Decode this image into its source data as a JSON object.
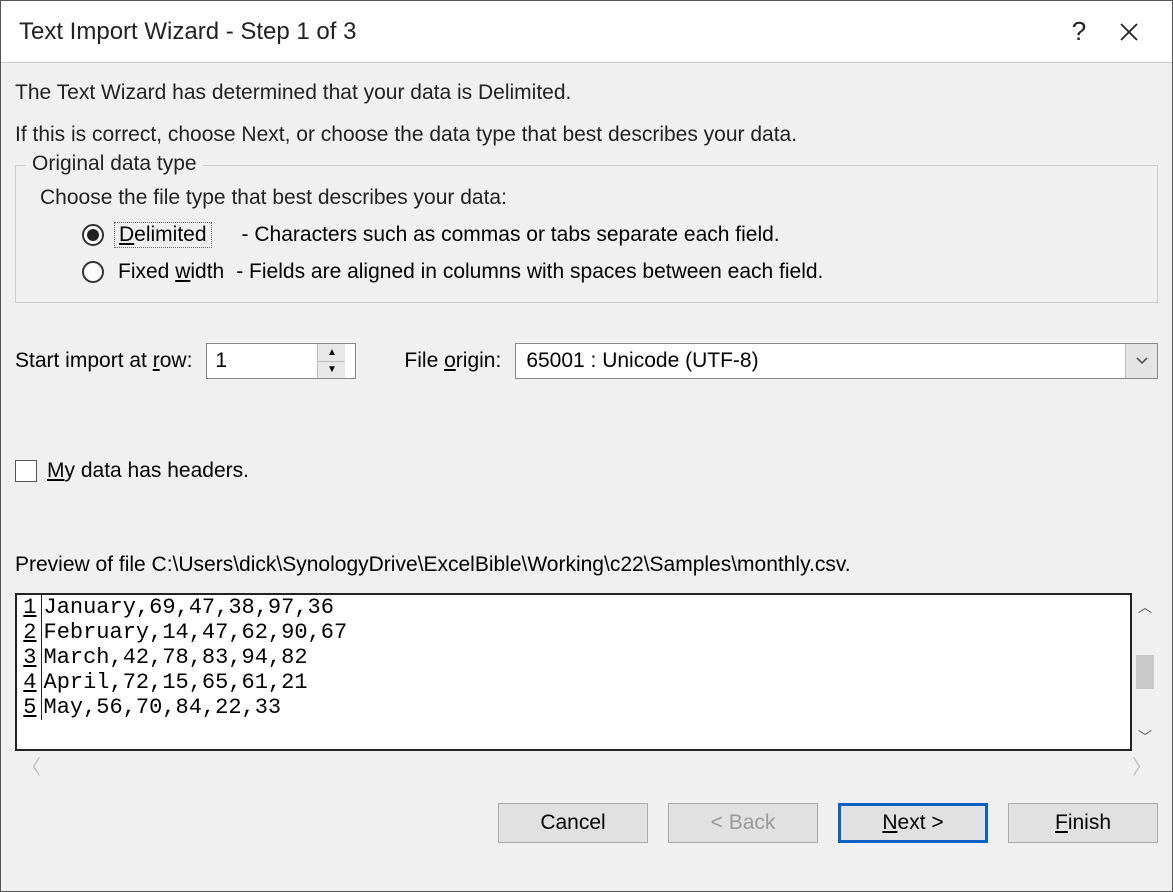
{
  "title": "Text Import Wizard - Step 1 of 3",
  "intro": {
    "line1": "The Text Wizard has determined that your data is Delimited.",
    "line2": "If this is correct, choose Next, or choose the data type that best describes your data."
  },
  "group": {
    "legend": "Original data type",
    "instruction": "Choose the file type that best describes your data:",
    "options": [
      {
        "label_pre": "",
        "label_u": "D",
        "label_post": "elimited",
        "desc": "- Characters such as commas or tabs separate each field.",
        "selected": true
      },
      {
        "label_pre": "Fixed ",
        "label_u": "w",
        "label_post": "idth",
        "desc": "- Fields are aligned in columns with spaces between each field.",
        "selected": false
      }
    ]
  },
  "startRow": {
    "label_pre": "Start import at ",
    "label_u": "r",
    "label_post": "ow:",
    "value": "1"
  },
  "fileOrigin": {
    "label_pre": "File ",
    "label_u": "o",
    "label_post": "rigin:",
    "value": "65001 : Unicode (UTF-8)"
  },
  "headersCheck": {
    "label_u": "M",
    "label_post": "y data has headers.",
    "checked": false
  },
  "preview": {
    "label": "Preview of file C:\\Users\\dick\\SynologyDrive\\ExcelBible\\Working\\c22\\Samples\\monthly.csv.",
    "rows": [
      {
        "n": "1",
        "text": "January,69,47,38,97,36"
      },
      {
        "n": "2",
        "text": "February,14,47,62,90,67"
      },
      {
        "n": "3",
        "text": "March,42,78,83,94,82"
      },
      {
        "n": "4",
        "text": "April,72,15,65,61,21"
      },
      {
        "n": "5",
        "text": "May,56,70,84,22,33"
      }
    ]
  },
  "buttons": {
    "cancel": "Cancel",
    "back": "< Back",
    "next_u": "N",
    "next_post": "ext >",
    "finish_u": "F",
    "finish_post": "inish"
  }
}
